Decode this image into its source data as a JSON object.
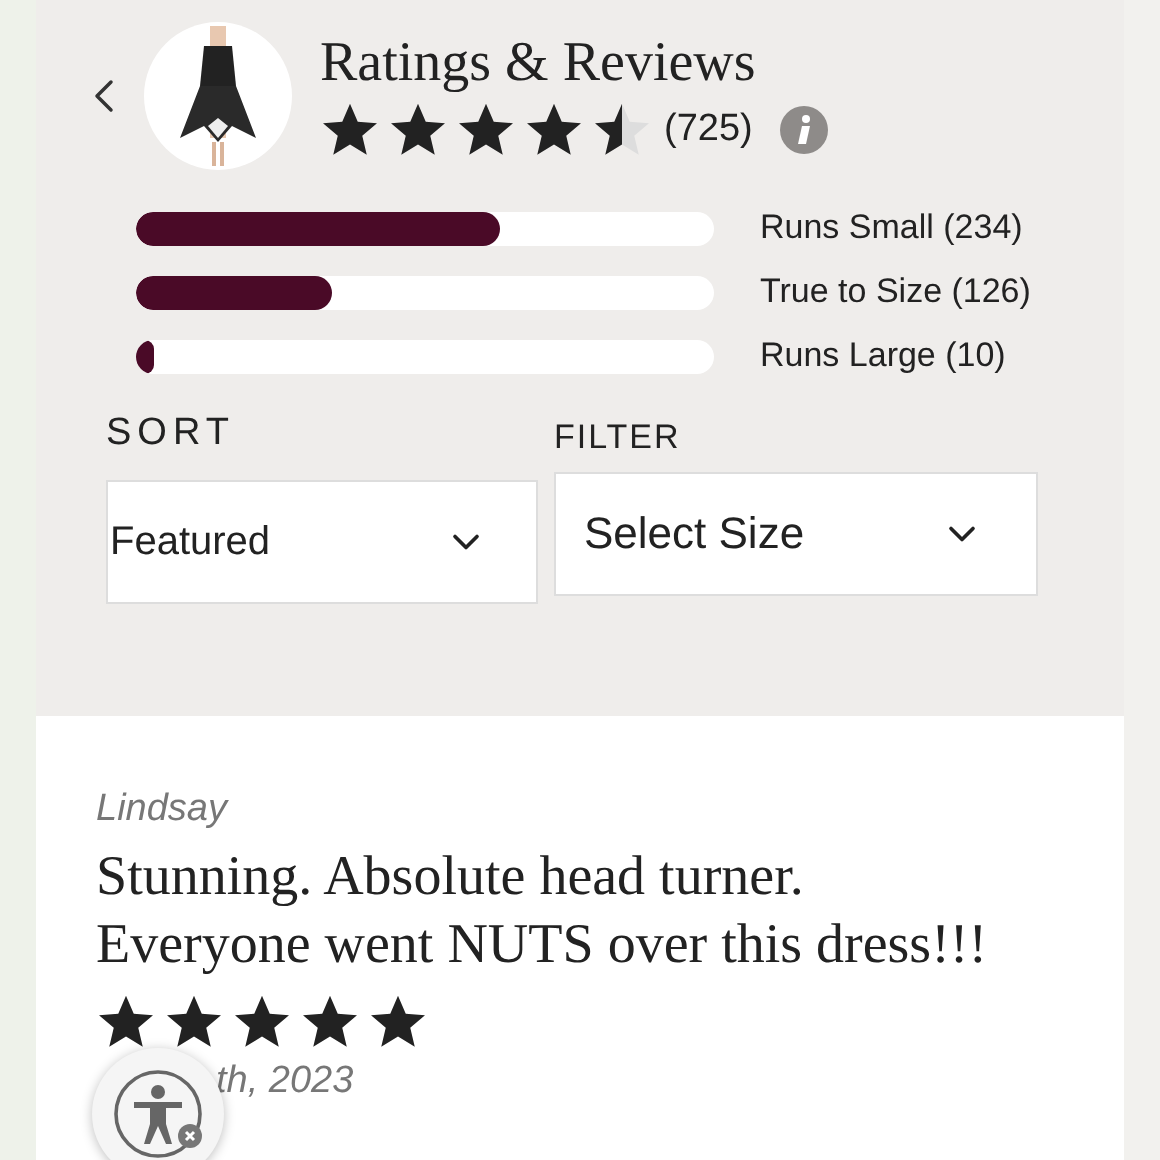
{
  "header": {
    "title": "Ratings & Reviews",
    "stars": 4.5,
    "count": "(725)"
  },
  "fit_bars": [
    {
      "label": "Runs Small (234)",
      "level": 0.63
    },
    {
      "label": "True to Size (126)",
      "level": 0.34
    },
    {
      "label": "Runs Large (10)",
      "level": 0.03
    }
  ],
  "sort": {
    "label": "SORT",
    "value": "Featured"
  },
  "filter": {
    "label": "FILTER",
    "value": "Select Size"
  },
  "review": {
    "author": "Lindsay",
    "title": "Stunning. Absolute head turner. Everyone went NUTS over this dress!!!",
    "stars": 5,
    "date": "th, 2023"
  }
}
